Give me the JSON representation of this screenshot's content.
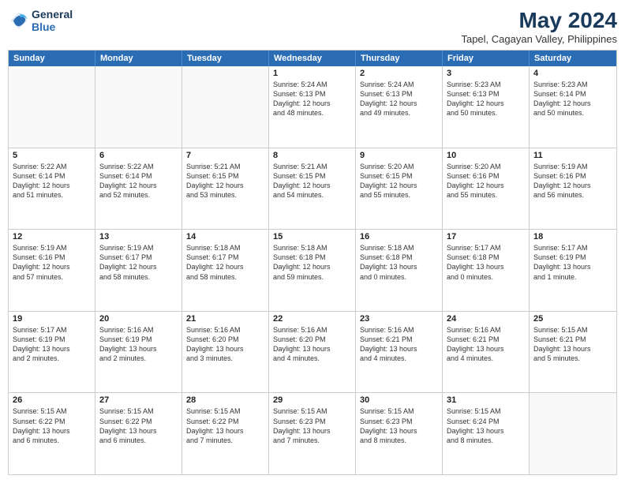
{
  "header": {
    "logo_line1": "General",
    "logo_line2": "Blue",
    "title": "May 2024",
    "subtitle": "Tapel, Cagayan Valley, Philippines"
  },
  "calendar": {
    "days": [
      "Sunday",
      "Monday",
      "Tuesday",
      "Wednesday",
      "Thursday",
      "Friday",
      "Saturday"
    ],
    "rows": [
      [
        {
          "day": "",
          "info": ""
        },
        {
          "day": "",
          "info": ""
        },
        {
          "day": "",
          "info": ""
        },
        {
          "day": "1",
          "info": "Sunrise: 5:24 AM\nSunset: 6:13 PM\nDaylight: 12 hours\nand 48 minutes."
        },
        {
          "day": "2",
          "info": "Sunrise: 5:24 AM\nSunset: 6:13 PM\nDaylight: 12 hours\nand 49 minutes."
        },
        {
          "day": "3",
          "info": "Sunrise: 5:23 AM\nSunset: 6:13 PM\nDaylight: 12 hours\nand 50 minutes."
        },
        {
          "day": "4",
          "info": "Sunrise: 5:23 AM\nSunset: 6:14 PM\nDaylight: 12 hours\nand 50 minutes."
        }
      ],
      [
        {
          "day": "5",
          "info": "Sunrise: 5:22 AM\nSunset: 6:14 PM\nDaylight: 12 hours\nand 51 minutes."
        },
        {
          "day": "6",
          "info": "Sunrise: 5:22 AM\nSunset: 6:14 PM\nDaylight: 12 hours\nand 52 minutes."
        },
        {
          "day": "7",
          "info": "Sunrise: 5:21 AM\nSunset: 6:15 PM\nDaylight: 12 hours\nand 53 minutes."
        },
        {
          "day": "8",
          "info": "Sunrise: 5:21 AM\nSunset: 6:15 PM\nDaylight: 12 hours\nand 54 minutes."
        },
        {
          "day": "9",
          "info": "Sunrise: 5:20 AM\nSunset: 6:15 PM\nDaylight: 12 hours\nand 55 minutes."
        },
        {
          "day": "10",
          "info": "Sunrise: 5:20 AM\nSunset: 6:16 PM\nDaylight: 12 hours\nand 55 minutes."
        },
        {
          "day": "11",
          "info": "Sunrise: 5:19 AM\nSunset: 6:16 PM\nDaylight: 12 hours\nand 56 minutes."
        }
      ],
      [
        {
          "day": "12",
          "info": "Sunrise: 5:19 AM\nSunset: 6:16 PM\nDaylight: 12 hours\nand 57 minutes."
        },
        {
          "day": "13",
          "info": "Sunrise: 5:19 AM\nSunset: 6:17 PM\nDaylight: 12 hours\nand 58 minutes."
        },
        {
          "day": "14",
          "info": "Sunrise: 5:18 AM\nSunset: 6:17 PM\nDaylight: 12 hours\nand 58 minutes."
        },
        {
          "day": "15",
          "info": "Sunrise: 5:18 AM\nSunset: 6:18 PM\nDaylight: 12 hours\nand 59 minutes."
        },
        {
          "day": "16",
          "info": "Sunrise: 5:18 AM\nSunset: 6:18 PM\nDaylight: 13 hours\nand 0 minutes."
        },
        {
          "day": "17",
          "info": "Sunrise: 5:17 AM\nSunset: 6:18 PM\nDaylight: 13 hours\nand 0 minutes."
        },
        {
          "day": "18",
          "info": "Sunrise: 5:17 AM\nSunset: 6:19 PM\nDaylight: 13 hours\nand 1 minute."
        }
      ],
      [
        {
          "day": "19",
          "info": "Sunrise: 5:17 AM\nSunset: 6:19 PM\nDaylight: 13 hours\nand 2 minutes."
        },
        {
          "day": "20",
          "info": "Sunrise: 5:16 AM\nSunset: 6:19 PM\nDaylight: 13 hours\nand 2 minutes."
        },
        {
          "day": "21",
          "info": "Sunrise: 5:16 AM\nSunset: 6:20 PM\nDaylight: 13 hours\nand 3 minutes."
        },
        {
          "day": "22",
          "info": "Sunrise: 5:16 AM\nSunset: 6:20 PM\nDaylight: 13 hours\nand 4 minutes."
        },
        {
          "day": "23",
          "info": "Sunrise: 5:16 AM\nSunset: 6:21 PM\nDaylight: 13 hours\nand 4 minutes."
        },
        {
          "day": "24",
          "info": "Sunrise: 5:16 AM\nSunset: 6:21 PM\nDaylight: 13 hours\nand 4 minutes."
        },
        {
          "day": "25",
          "info": "Sunrise: 5:15 AM\nSunset: 6:21 PM\nDaylight: 13 hours\nand 5 minutes."
        }
      ],
      [
        {
          "day": "26",
          "info": "Sunrise: 5:15 AM\nSunset: 6:22 PM\nDaylight: 13 hours\nand 6 minutes."
        },
        {
          "day": "27",
          "info": "Sunrise: 5:15 AM\nSunset: 6:22 PM\nDaylight: 13 hours\nand 6 minutes."
        },
        {
          "day": "28",
          "info": "Sunrise: 5:15 AM\nSunset: 6:22 PM\nDaylight: 13 hours\nand 7 minutes."
        },
        {
          "day": "29",
          "info": "Sunrise: 5:15 AM\nSunset: 6:23 PM\nDaylight: 13 hours\nand 7 minutes."
        },
        {
          "day": "30",
          "info": "Sunrise: 5:15 AM\nSunset: 6:23 PM\nDaylight: 13 hours\nand 8 minutes."
        },
        {
          "day": "31",
          "info": "Sunrise: 5:15 AM\nSunset: 6:24 PM\nDaylight: 13 hours\nand 8 minutes."
        },
        {
          "day": "",
          "info": ""
        }
      ]
    ]
  }
}
